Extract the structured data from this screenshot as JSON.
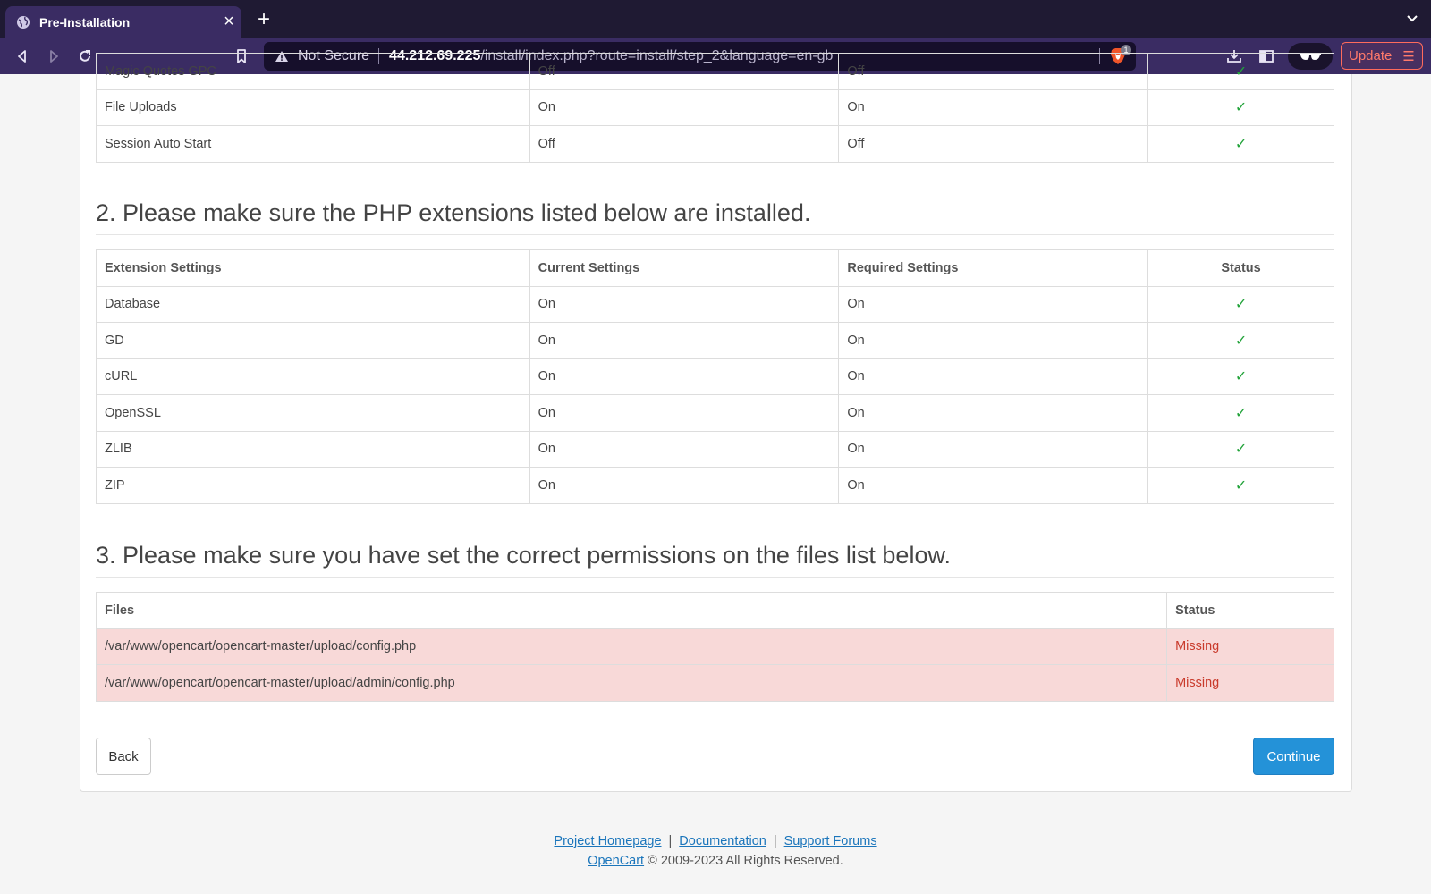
{
  "browser": {
    "tab_title": "Pre-Installation",
    "tab_close": "×",
    "new_tab": "+",
    "tab_menu": "⌄",
    "url_not_secure": "Not Secure",
    "url_host": "44.212.69.225",
    "url_path": "/install/index.php?route=install/step_2&language=en-gb",
    "shield_count": "1",
    "update_label": "Update",
    "update_menu_icon": "☰"
  },
  "php_settings_partial": {
    "rows": [
      {
        "name": "Magic Quotes GPC",
        "current": "Off",
        "required": "Off",
        "status": "✓"
      },
      {
        "name": "File Uploads",
        "current": "On",
        "required": "On",
        "status": "✓"
      },
      {
        "name": "Session Auto Start",
        "current": "Off",
        "required": "Off",
        "status": "✓"
      }
    ]
  },
  "extensions": {
    "title": "2. Please make sure the PHP extensions listed below are installed.",
    "headers": [
      "Extension Settings",
      "Current Settings",
      "Required Settings",
      "Status"
    ],
    "rows": [
      {
        "name": "Database",
        "current": "On",
        "required": "On",
        "status": "✓"
      },
      {
        "name": "GD",
        "current": "On",
        "required": "On",
        "status": "✓"
      },
      {
        "name": "cURL",
        "current": "On",
        "required": "On",
        "status": "✓"
      },
      {
        "name": "OpenSSL",
        "current": "On",
        "required": "On",
        "status": "✓"
      },
      {
        "name": "ZLIB",
        "current": "On",
        "required": "On",
        "status": "✓"
      },
      {
        "name": "ZIP",
        "current": "On",
        "required": "On",
        "status": "✓"
      }
    ]
  },
  "permissions": {
    "title": "3. Please make sure you have set the correct permissions on the files list below.",
    "headers": [
      "Files",
      "Status"
    ],
    "rows": [
      {
        "file": "/var/www/opencart/opencart-master/upload/config.php",
        "status": "Missing"
      },
      {
        "file": "/var/www/opencart/opencart-master/upload/admin/config.php",
        "status": "Missing"
      }
    ]
  },
  "actions": {
    "back": "Back",
    "continue": "Continue"
  },
  "footer": {
    "link_homepage": "Project Homepage",
    "link_docs": "Documentation",
    "link_forums": "Support Forums",
    "sep": "|",
    "brand": "OpenCart",
    "copyright": "© 2009-2023 All Rights Reserved."
  },
  "colors": {
    "check": "#22a33a",
    "missing_text": "#c93a2b",
    "missing_bg": "#f8d9d8",
    "continue_bg": "#2492d8",
    "browser_toolbar": "#3a2c63"
  }
}
